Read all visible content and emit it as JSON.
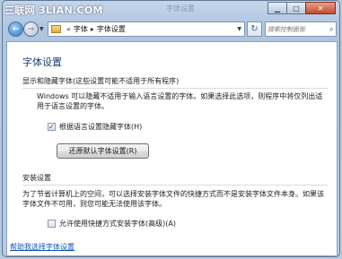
{
  "window": {
    "watermark": "三联网 3LIAN.COM",
    "faded_title": "字体设置"
  },
  "navigation": {
    "breadcrumb": [
      "字体",
      "字体设置"
    ],
    "breadcrumb_prefix": "«",
    "search_placeholder": "搜索控制面板"
  },
  "page": {
    "title": "字体设置",
    "hide_section": {
      "title": "显示和隐藏字体(这些设置可能不适用于所有程序)",
      "description": "Windows 可以隐藏不适用于输入语言设置的字体。如果选择此选项，则程序中将仅列出适用于语言设置的字体。",
      "checkbox_label": "根据语言设置隐藏字体(H)",
      "checkbox_checked": true,
      "restore_button": "还原默认字体设置(R)"
    },
    "install_section": {
      "title": "安装设置",
      "description": "为了节省计算机上的空间，可以选择安装字体文件的快捷方式而不是安装字体文件本身。如果该字体文件不可用，则您可能无法使用该字体。",
      "checkbox_label": "允许使用快捷方式安装字体(高级)(A)",
      "checkbox_checked": false
    },
    "help_link": "帮助我选择字体设置"
  }
}
